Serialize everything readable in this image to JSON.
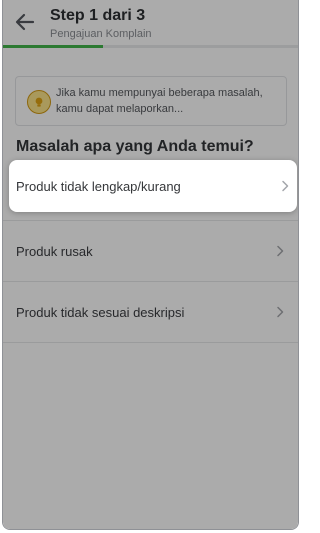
{
  "header": {
    "step_title": "Step 1 dari 3",
    "subtitle": "Pengajuan Komplain",
    "progress_fraction": 0.34,
    "progress_color": "#42b549",
    "back_icon": "arrow-left-icon"
  },
  "info": {
    "icon": "lightbulb-icon",
    "text": "Jika kamu mempunyai beberapa masalah, kamu dapat melaporkan..."
  },
  "question": "Masalah apa yang Anda temui?",
  "options": [
    {
      "label": "Produk tidak lengkap/kurang",
      "highlighted": true
    },
    {
      "label": "Produk rusak"
    },
    {
      "label": "Produk tidak sesuai deskripsi"
    }
  ],
  "chevron_icon": "chevron-right-icon"
}
